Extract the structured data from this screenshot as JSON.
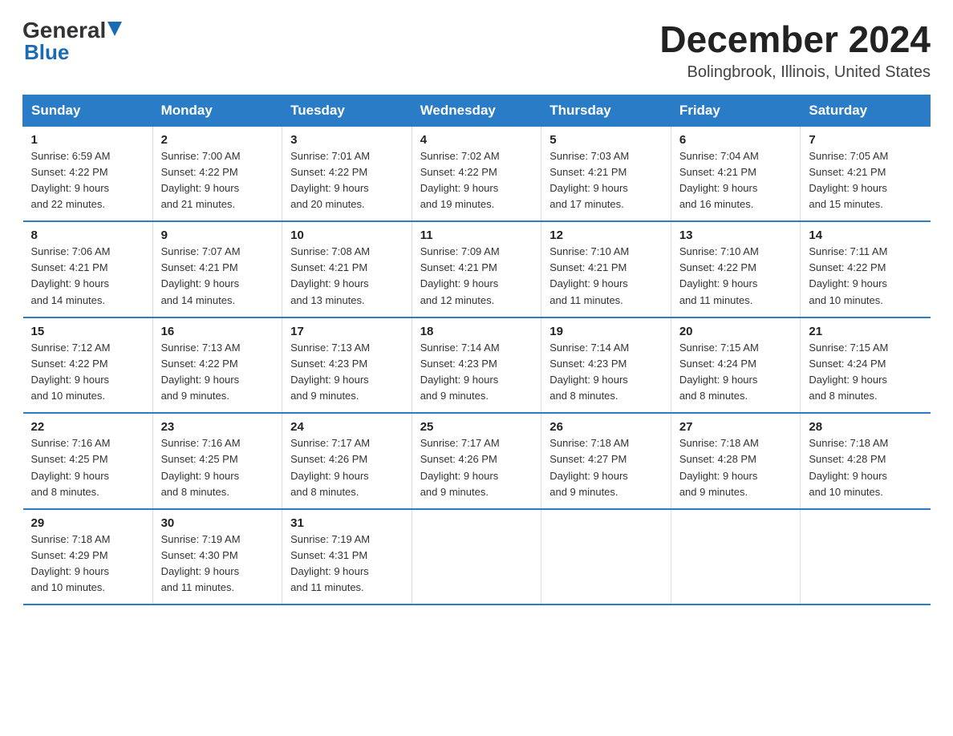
{
  "logo": {
    "general": "General",
    "blue": "Blue",
    "arrow": true
  },
  "header": {
    "title": "December 2024",
    "location": "Bolingbrook, Illinois, United States"
  },
  "days_of_week": [
    "Sunday",
    "Monday",
    "Tuesday",
    "Wednesday",
    "Thursday",
    "Friday",
    "Saturday"
  ],
  "weeks": [
    [
      {
        "day": "1",
        "sunrise": "Sunrise: 6:59 AM",
        "sunset": "Sunset: 4:22 PM",
        "daylight": "Daylight: 9 hours",
        "daylight2": "and 22 minutes."
      },
      {
        "day": "2",
        "sunrise": "Sunrise: 7:00 AM",
        "sunset": "Sunset: 4:22 PM",
        "daylight": "Daylight: 9 hours",
        "daylight2": "and 21 minutes."
      },
      {
        "day": "3",
        "sunrise": "Sunrise: 7:01 AM",
        "sunset": "Sunset: 4:22 PM",
        "daylight": "Daylight: 9 hours",
        "daylight2": "and 20 minutes."
      },
      {
        "day": "4",
        "sunrise": "Sunrise: 7:02 AM",
        "sunset": "Sunset: 4:22 PM",
        "daylight": "Daylight: 9 hours",
        "daylight2": "and 19 minutes."
      },
      {
        "day": "5",
        "sunrise": "Sunrise: 7:03 AM",
        "sunset": "Sunset: 4:21 PM",
        "daylight": "Daylight: 9 hours",
        "daylight2": "and 17 minutes."
      },
      {
        "day": "6",
        "sunrise": "Sunrise: 7:04 AM",
        "sunset": "Sunset: 4:21 PM",
        "daylight": "Daylight: 9 hours",
        "daylight2": "and 16 minutes."
      },
      {
        "day": "7",
        "sunrise": "Sunrise: 7:05 AM",
        "sunset": "Sunset: 4:21 PM",
        "daylight": "Daylight: 9 hours",
        "daylight2": "and 15 minutes."
      }
    ],
    [
      {
        "day": "8",
        "sunrise": "Sunrise: 7:06 AM",
        "sunset": "Sunset: 4:21 PM",
        "daylight": "Daylight: 9 hours",
        "daylight2": "and 14 minutes."
      },
      {
        "day": "9",
        "sunrise": "Sunrise: 7:07 AM",
        "sunset": "Sunset: 4:21 PM",
        "daylight": "Daylight: 9 hours",
        "daylight2": "and 14 minutes."
      },
      {
        "day": "10",
        "sunrise": "Sunrise: 7:08 AM",
        "sunset": "Sunset: 4:21 PM",
        "daylight": "Daylight: 9 hours",
        "daylight2": "and 13 minutes."
      },
      {
        "day": "11",
        "sunrise": "Sunrise: 7:09 AM",
        "sunset": "Sunset: 4:21 PM",
        "daylight": "Daylight: 9 hours",
        "daylight2": "and 12 minutes."
      },
      {
        "day": "12",
        "sunrise": "Sunrise: 7:10 AM",
        "sunset": "Sunset: 4:21 PM",
        "daylight": "Daylight: 9 hours",
        "daylight2": "and 11 minutes."
      },
      {
        "day": "13",
        "sunrise": "Sunrise: 7:10 AM",
        "sunset": "Sunset: 4:22 PM",
        "daylight": "Daylight: 9 hours",
        "daylight2": "and 11 minutes."
      },
      {
        "day": "14",
        "sunrise": "Sunrise: 7:11 AM",
        "sunset": "Sunset: 4:22 PM",
        "daylight": "Daylight: 9 hours",
        "daylight2": "and 10 minutes."
      }
    ],
    [
      {
        "day": "15",
        "sunrise": "Sunrise: 7:12 AM",
        "sunset": "Sunset: 4:22 PM",
        "daylight": "Daylight: 9 hours",
        "daylight2": "and 10 minutes."
      },
      {
        "day": "16",
        "sunrise": "Sunrise: 7:13 AM",
        "sunset": "Sunset: 4:22 PM",
        "daylight": "Daylight: 9 hours",
        "daylight2": "and 9 minutes."
      },
      {
        "day": "17",
        "sunrise": "Sunrise: 7:13 AM",
        "sunset": "Sunset: 4:23 PM",
        "daylight": "Daylight: 9 hours",
        "daylight2": "and 9 minutes."
      },
      {
        "day": "18",
        "sunrise": "Sunrise: 7:14 AM",
        "sunset": "Sunset: 4:23 PM",
        "daylight": "Daylight: 9 hours",
        "daylight2": "and 9 minutes."
      },
      {
        "day": "19",
        "sunrise": "Sunrise: 7:14 AM",
        "sunset": "Sunset: 4:23 PM",
        "daylight": "Daylight: 9 hours",
        "daylight2": "and 8 minutes."
      },
      {
        "day": "20",
        "sunrise": "Sunrise: 7:15 AM",
        "sunset": "Sunset: 4:24 PM",
        "daylight": "Daylight: 9 hours",
        "daylight2": "and 8 minutes."
      },
      {
        "day": "21",
        "sunrise": "Sunrise: 7:15 AM",
        "sunset": "Sunset: 4:24 PM",
        "daylight": "Daylight: 9 hours",
        "daylight2": "and 8 minutes."
      }
    ],
    [
      {
        "day": "22",
        "sunrise": "Sunrise: 7:16 AM",
        "sunset": "Sunset: 4:25 PM",
        "daylight": "Daylight: 9 hours",
        "daylight2": "and 8 minutes."
      },
      {
        "day": "23",
        "sunrise": "Sunrise: 7:16 AM",
        "sunset": "Sunset: 4:25 PM",
        "daylight": "Daylight: 9 hours",
        "daylight2": "and 8 minutes."
      },
      {
        "day": "24",
        "sunrise": "Sunrise: 7:17 AM",
        "sunset": "Sunset: 4:26 PM",
        "daylight": "Daylight: 9 hours",
        "daylight2": "and 8 minutes."
      },
      {
        "day": "25",
        "sunrise": "Sunrise: 7:17 AM",
        "sunset": "Sunset: 4:26 PM",
        "daylight": "Daylight: 9 hours",
        "daylight2": "and 9 minutes."
      },
      {
        "day": "26",
        "sunrise": "Sunrise: 7:18 AM",
        "sunset": "Sunset: 4:27 PM",
        "daylight": "Daylight: 9 hours",
        "daylight2": "and 9 minutes."
      },
      {
        "day": "27",
        "sunrise": "Sunrise: 7:18 AM",
        "sunset": "Sunset: 4:28 PM",
        "daylight": "Daylight: 9 hours",
        "daylight2": "and 9 minutes."
      },
      {
        "day": "28",
        "sunrise": "Sunrise: 7:18 AM",
        "sunset": "Sunset: 4:28 PM",
        "daylight": "Daylight: 9 hours",
        "daylight2": "and 10 minutes."
      }
    ],
    [
      {
        "day": "29",
        "sunrise": "Sunrise: 7:18 AM",
        "sunset": "Sunset: 4:29 PM",
        "daylight": "Daylight: 9 hours",
        "daylight2": "and 10 minutes."
      },
      {
        "day": "30",
        "sunrise": "Sunrise: 7:19 AM",
        "sunset": "Sunset: 4:30 PM",
        "daylight": "Daylight: 9 hours",
        "daylight2": "and 11 minutes."
      },
      {
        "day": "31",
        "sunrise": "Sunrise: 7:19 AM",
        "sunset": "Sunset: 4:31 PM",
        "daylight": "Daylight: 9 hours",
        "daylight2": "and 11 minutes."
      },
      null,
      null,
      null,
      null
    ]
  ]
}
